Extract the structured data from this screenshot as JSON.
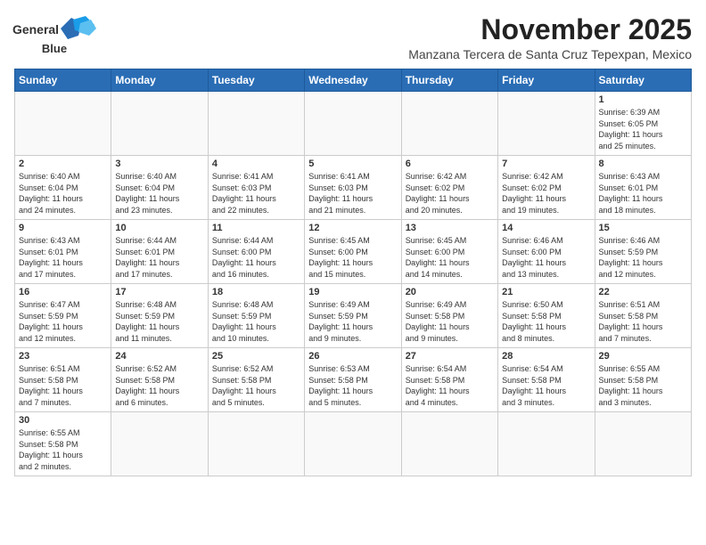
{
  "header": {
    "logo_line1": "General",
    "logo_line2": "Blue",
    "month": "November 2025",
    "location": "Manzana Tercera de Santa Cruz Tepexpan, Mexico"
  },
  "weekdays": [
    "Sunday",
    "Monday",
    "Tuesday",
    "Wednesday",
    "Thursday",
    "Friday",
    "Saturday"
  ],
  "weeks": [
    [
      {
        "day": "",
        "info": ""
      },
      {
        "day": "",
        "info": ""
      },
      {
        "day": "",
        "info": ""
      },
      {
        "day": "",
        "info": ""
      },
      {
        "day": "",
        "info": ""
      },
      {
        "day": "",
        "info": ""
      },
      {
        "day": "1",
        "info": "Sunrise: 6:39 AM\nSunset: 6:05 PM\nDaylight: 11 hours\nand 25 minutes."
      }
    ],
    [
      {
        "day": "2",
        "info": "Sunrise: 6:40 AM\nSunset: 6:04 PM\nDaylight: 11 hours\nand 24 minutes."
      },
      {
        "day": "3",
        "info": "Sunrise: 6:40 AM\nSunset: 6:04 PM\nDaylight: 11 hours\nand 23 minutes."
      },
      {
        "day": "4",
        "info": "Sunrise: 6:41 AM\nSunset: 6:03 PM\nDaylight: 11 hours\nand 22 minutes."
      },
      {
        "day": "5",
        "info": "Sunrise: 6:41 AM\nSunset: 6:03 PM\nDaylight: 11 hours\nand 21 minutes."
      },
      {
        "day": "6",
        "info": "Sunrise: 6:42 AM\nSunset: 6:02 PM\nDaylight: 11 hours\nand 20 minutes."
      },
      {
        "day": "7",
        "info": "Sunrise: 6:42 AM\nSunset: 6:02 PM\nDaylight: 11 hours\nand 19 minutes."
      },
      {
        "day": "8",
        "info": "Sunrise: 6:43 AM\nSunset: 6:01 PM\nDaylight: 11 hours\nand 18 minutes."
      }
    ],
    [
      {
        "day": "9",
        "info": "Sunrise: 6:43 AM\nSunset: 6:01 PM\nDaylight: 11 hours\nand 17 minutes."
      },
      {
        "day": "10",
        "info": "Sunrise: 6:44 AM\nSunset: 6:01 PM\nDaylight: 11 hours\nand 17 minutes."
      },
      {
        "day": "11",
        "info": "Sunrise: 6:44 AM\nSunset: 6:00 PM\nDaylight: 11 hours\nand 16 minutes."
      },
      {
        "day": "12",
        "info": "Sunrise: 6:45 AM\nSunset: 6:00 PM\nDaylight: 11 hours\nand 15 minutes."
      },
      {
        "day": "13",
        "info": "Sunrise: 6:45 AM\nSunset: 6:00 PM\nDaylight: 11 hours\nand 14 minutes."
      },
      {
        "day": "14",
        "info": "Sunrise: 6:46 AM\nSunset: 6:00 PM\nDaylight: 11 hours\nand 13 minutes."
      },
      {
        "day": "15",
        "info": "Sunrise: 6:46 AM\nSunset: 5:59 PM\nDaylight: 11 hours\nand 12 minutes."
      }
    ],
    [
      {
        "day": "16",
        "info": "Sunrise: 6:47 AM\nSunset: 5:59 PM\nDaylight: 11 hours\nand 12 minutes."
      },
      {
        "day": "17",
        "info": "Sunrise: 6:48 AM\nSunset: 5:59 PM\nDaylight: 11 hours\nand 11 minutes."
      },
      {
        "day": "18",
        "info": "Sunrise: 6:48 AM\nSunset: 5:59 PM\nDaylight: 11 hours\nand 10 minutes."
      },
      {
        "day": "19",
        "info": "Sunrise: 6:49 AM\nSunset: 5:59 PM\nDaylight: 11 hours\nand 9 minutes."
      },
      {
        "day": "20",
        "info": "Sunrise: 6:49 AM\nSunset: 5:58 PM\nDaylight: 11 hours\nand 9 minutes."
      },
      {
        "day": "21",
        "info": "Sunrise: 6:50 AM\nSunset: 5:58 PM\nDaylight: 11 hours\nand 8 minutes."
      },
      {
        "day": "22",
        "info": "Sunrise: 6:51 AM\nSunset: 5:58 PM\nDaylight: 11 hours\nand 7 minutes."
      }
    ],
    [
      {
        "day": "23",
        "info": "Sunrise: 6:51 AM\nSunset: 5:58 PM\nDaylight: 11 hours\nand 7 minutes."
      },
      {
        "day": "24",
        "info": "Sunrise: 6:52 AM\nSunset: 5:58 PM\nDaylight: 11 hours\nand 6 minutes."
      },
      {
        "day": "25",
        "info": "Sunrise: 6:52 AM\nSunset: 5:58 PM\nDaylight: 11 hours\nand 5 minutes."
      },
      {
        "day": "26",
        "info": "Sunrise: 6:53 AM\nSunset: 5:58 PM\nDaylight: 11 hours\nand 5 minutes."
      },
      {
        "day": "27",
        "info": "Sunrise: 6:54 AM\nSunset: 5:58 PM\nDaylight: 11 hours\nand 4 minutes."
      },
      {
        "day": "28",
        "info": "Sunrise: 6:54 AM\nSunset: 5:58 PM\nDaylight: 11 hours\nand 3 minutes."
      },
      {
        "day": "29",
        "info": "Sunrise: 6:55 AM\nSunset: 5:58 PM\nDaylight: 11 hours\nand 3 minutes."
      }
    ],
    [
      {
        "day": "30",
        "info": "Sunrise: 6:55 AM\nSunset: 5:58 PM\nDaylight: 11 hours\nand 2 minutes."
      },
      {
        "day": "",
        "info": ""
      },
      {
        "day": "",
        "info": ""
      },
      {
        "day": "",
        "info": ""
      },
      {
        "day": "",
        "info": ""
      },
      {
        "day": "",
        "info": ""
      },
      {
        "day": "",
        "info": ""
      }
    ]
  ]
}
